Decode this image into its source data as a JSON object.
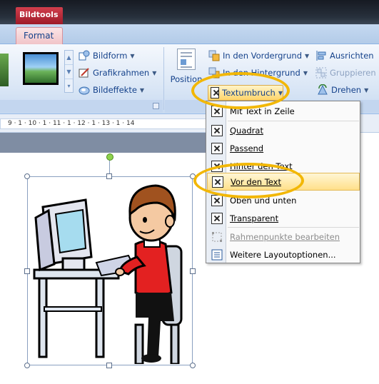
{
  "window": {
    "context_tab": "Bildtools"
  },
  "ribbon_tabs": {
    "active": "Format"
  },
  "ribbon": {
    "picture_styles": {
      "bildform": "Bildform",
      "grafikrahmen": "Grafikrahmen",
      "bildeffekte": "Bildeffekte"
    },
    "arrange": {
      "position": "Position",
      "in_den_vordergrund": "In den Vordergrund",
      "in_den_hintergrund": "In den Hintergrund",
      "textumbruch": "Textumbruch",
      "ausrichten": "Ausrichten",
      "gruppieren": "Gruppieren",
      "drehen": "Drehen"
    }
  },
  "ruler": {
    "ticks": "9 · 1 · 10 · 1 · 11 · 1 · 12 · 1 · 13 · 1 · 14"
  },
  "menu": {
    "items": [
      {
        "label": "Mit Text in Zeile",
        "highlighted": false,
        "disabled": false
      },
      {
        "label": "Quadrat",
        "highlighted": false,
        "disabled": false
      },
      {
        "label": "Passend",
        "highlighted": false,
        "disabled": false
      },
      {
        "label": "Hinter den Text",
        "highlighted": false,
        "disabled": false
      },
      {
        "label": "Vor den Text",
        "highlighted": true,
        "disabled": false
      },
      {
        "label": "Oben und unten",
        "highlighted": false,
        "disabled": false
      },
      {
        "label": "Transparent",
        "highlighted": false,
        "disabled": false
      },
      {
        "label": "Rahmenpunkte bearbeiten",
        "highlighted": false,
        "disabled": true
      },
      {
        "label": "Weitere Layoutoptionen...",
        "highlighted": false,
        "disabled": false
      }
    ]
  },
  "colors": {
    "ribbon_text": "#15428b",
    "context_tab": "#b42535",
    "annotation": "#f2b705",
    "highlight": "#ffe08a"
  }
}
